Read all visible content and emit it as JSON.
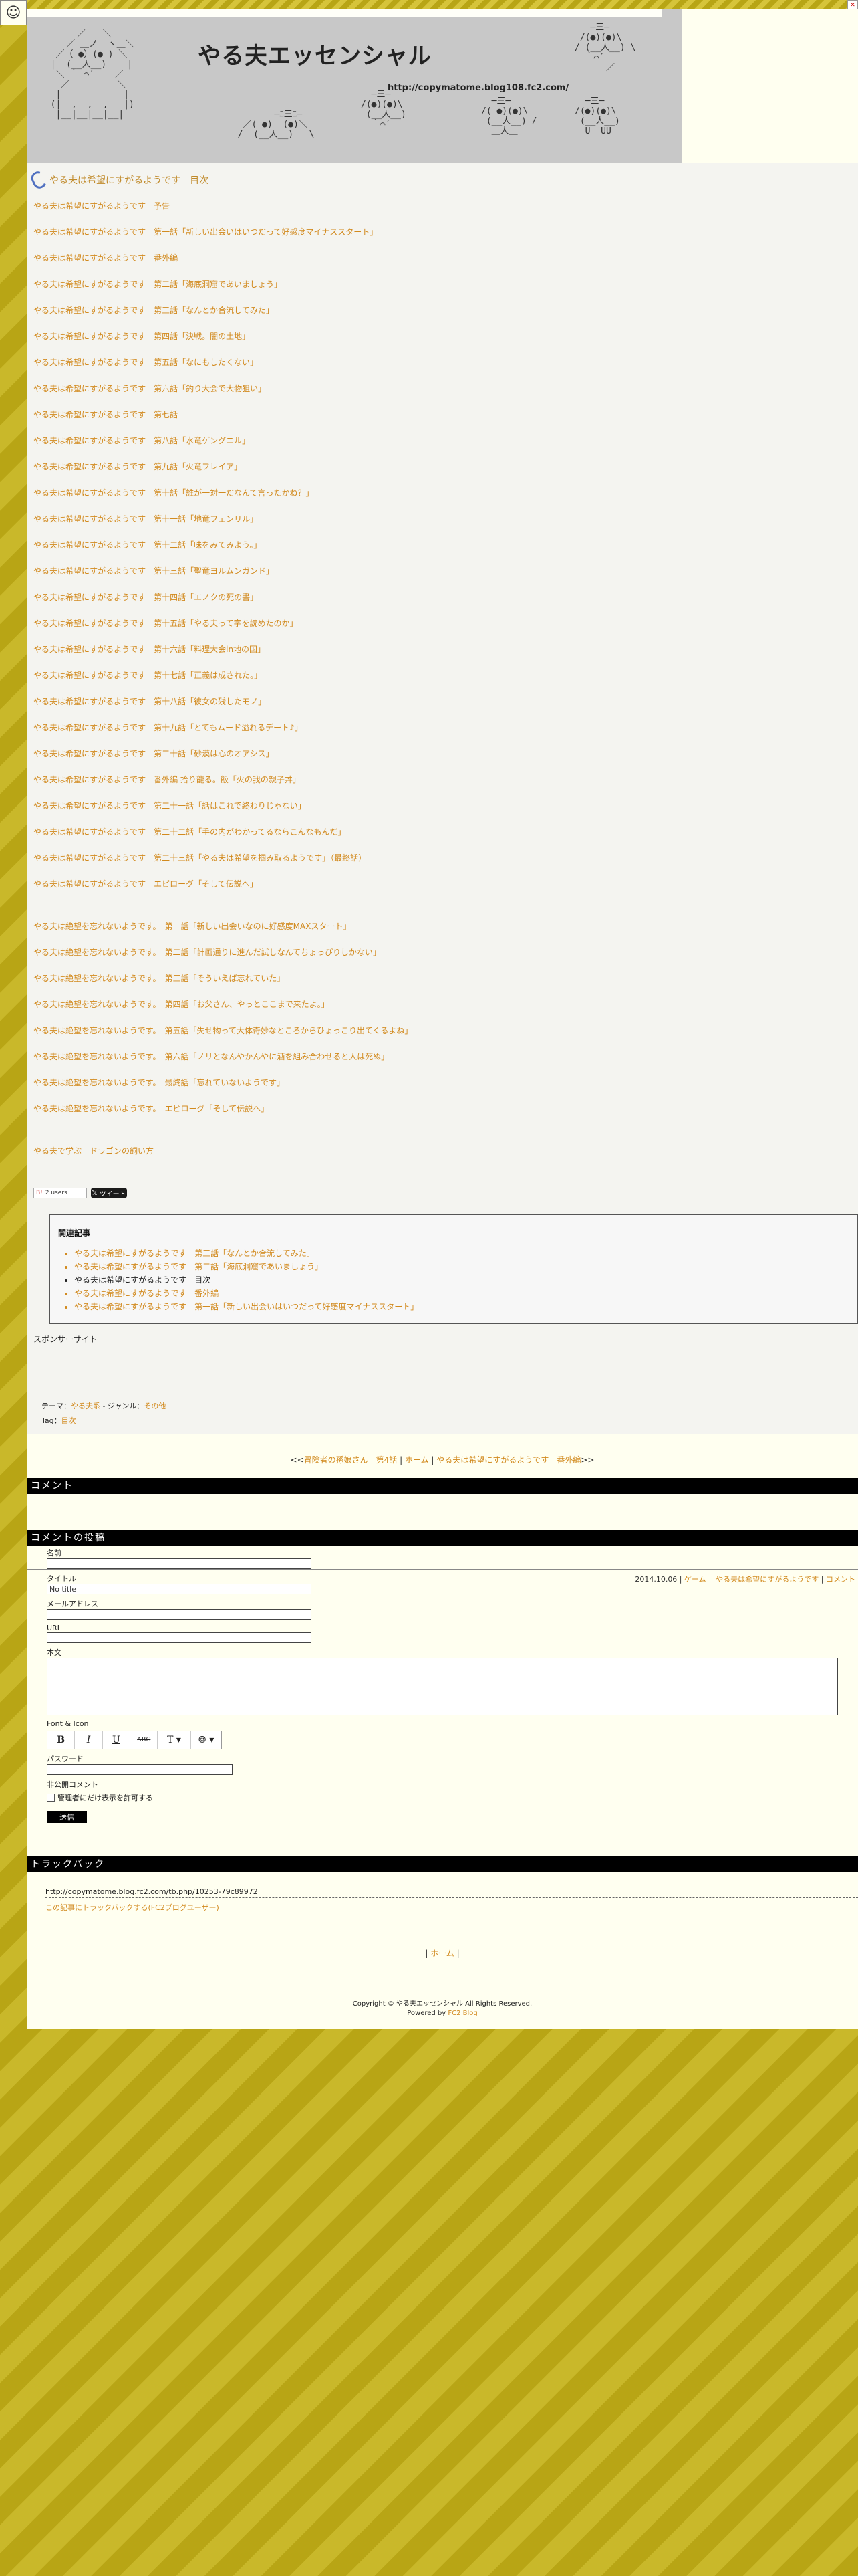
{
  "header": {
    "site_title": "やる夫エッセンシャル",
    "url": "http://copymatome.blog108.fc2.com/"
  },
  "entry": {
    "title": "やる夫は希望にすがるようです　目次",
    "toc_part1": [
      "やる夫は希望にすがるようです　予告",
      "やる夫は希望にすがるようです　第一話「新しい出会いはいつだって好感度マイナススタート」",
      "やる夫は希望にすがるようです　番外編",
      "やる夫は希望にすがるようです　第二話「海底洞窟であいましょう」",
      "やる夫は希望にすがるようです　第三話「なんとか合流してみた」",
      "やる夫は希望にすがるようです　第四話「決戦。闇の土地」",
      "やる夫は希望にすがるようです　第五話「なにもしたくない」",
      "やる夫は希望にすがるようです　第六話「釣り大会で大物狙い」",
      "やる夫は希望にすがるようです　第七話",
      "やる夫は希望にすがるようです　第八話「水竜ゲングニル」",
      "やる夫は希望にすがるようです　第九話「火竜フレイア」",
      "やる夫は希望にすがるようです　第十話「誰が一対一だなんて言ったかね？」",
      "やる夫は希望にすがるようです　第十一話「地竜フェンリル」",
      "やる夫は希望にすがるようです　第十二話「味をみてみよう。」",
      "やる夫は希望にすがるようです　第十三話「聖竜ヨルムンガンド」",
      "やる夫は希望にすがるようです　第十四話「エノクの死の書」",
      "やる夫は希望にすがるようです　第十五話「やる夫って字を読めたのか」",
      "やる夫は希望にすがるようです　第十六話「料理大会in地の国」",
      "やる夫は希望にすがるようです　第十七話「正義は成された。」",
      "やる夫は希望にすがるようです　第十八話「彼女の残したモノ」",
      "やる夫は希望にすがるようです　第十九話「とてもムード溢れるデート♪」",
      "やる夫は希望にすがるようです　第二十話「砂漠は心のオアシス」",
      "やる夫は希望にすがるようです　番外編 拾り龍る。飯「火の我の親子丼」",
      "やる夫は希望にすがるようです　第二十一話「話はこれで終わりじゃない」",
      "やる夫は希望にすがるようです　第二十二話「手の内がわかってるならこんなもんだ」",
      "やる夫は希望にすがるようです　第二十三話「やる夫は希望を掴み取るようです」（最終話）",
      "やる夫は希望にすがるようです　エピローグ「そして伝説へ」"
    ],
    "toc_part2": [
      "やる夫は絶望を忘れないようです。　第一話「新しい出会いなのに好感度MAXスタート」",
      "やる夫は絶望を忘れないようです。　第二話「計画通りに進んだ試しなんてちょっぴりしかない」",
      "やる夫は絶望を忘れないようです。　第三話「そういえば忘れていた」",
      "やる夫は絶望を忘れないようです。　第四話「お父さん、やっとここまで来たよ。」",
      "やる夫は絶望を忘れないようです。　第五話「失せ物って大体奇妙なところからひょっこり出てくるよね」",
      "やる夫は絶望を忘れないようです。　第六話「ノリとなんやかんやに酒を組み合わせると人は死ぬ」",
      "やる夫は絶望を忘れないようです。　最終話「忘れていないようです」",
      "やる夫は絶望を忘れないようです。　エピローグ「そして伝説へ」"
    ],
    "extra_link": "やる夫で学ぶ　ドラゴンの飼い方",
    "hatena_count": "2 users",
    "tweet_label": "ツイート",
    "related_heading": "関連記事",
    "related": [
      "やる夫は希望にすがるようです　第三話「なんとか合流してみた」",
      "やる夫は希望にすがるようです　第二話「海底洞窟であいましょう」",
      "やる夫は希望にすがるようです　目次",
      "やる夫は希望にすがるようです　番外編",
      "やる夫は希望にすがるようです　第一話「新しい出会いはいつだって好感度マイナススタート」"
    ],
    "sponsor_label": "スポンサーサイト",
    "theme_label": "テーマ：",
    "theme_value": "やる夫系",
    "genre_label": "ジャンル：",
    "genre_value": "その他",
    "tag_label": "Tag：",
    "tag_value": "目次",
    "date": "2014.10.06",
    "category_1": "ゲーム",
    "category_2": "やる夫は希望にすがるようです",
    "comment_link": "コメント"
  },
  "pager": {
    "prev": "冒険者の孫娘さん　第4話",
    "home": "ホーム",
    "next": "やる夫は希望にすがるようです　番外編"
  },
  "comments": {
    "heading": "コメント"
  },
  "comment_form": {
    "heading": "コメントの投稿",
    "name_label": "名前",
    "title_label": "タイトル",
    "title_value": "No title",
    "email_label": "メールアドレス",
    "url_label": "URL",
    "body_label": "本文",
    "font_label": "Font & Icon",
    "password_label": "パスワード",
    "private_label": "非公開コメント",
    "private_check_label": "管理者にだけ表示を許可する",
    "submit_label": "送信"
  },
  "trackback": {
    "heading": "トラックバック",
    "url": "http://copymatome.blog.fc2.com/tb.php/10253-79c89972",
    "link": "この記事にトラックバックする(FC2ブログユーザー)"
  },
  "home_nav": {
    "home": "ホーム"
  },
  "footer": {
    "copyright": "Copyright © やる夫エッセンシャル All Rights Reserved.",
    "powered_prefix": "Powered by ",
    "powered_link": "FC2 Blog"
  }
}
